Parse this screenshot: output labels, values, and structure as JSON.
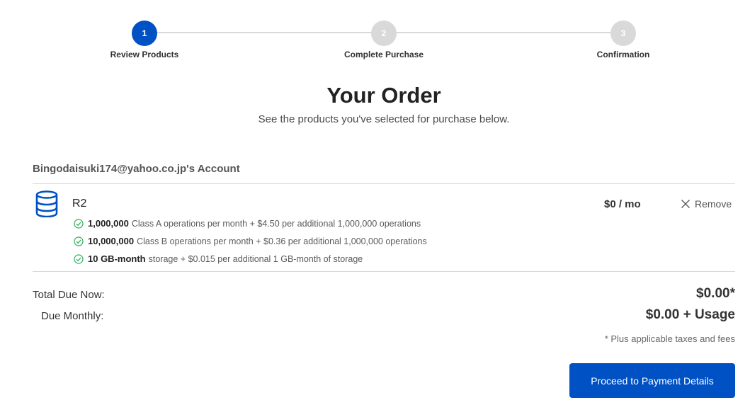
{
  "stepper": {
    "steps": [
      {
        "number": "1",
        "label": "Review Products",
        "active": true
      },
      {
        "number": "2",
        "label": "Complete Purchase",
        "active": false
      },
      {
        "number": "3",
        "label": "Confirmation",
        "active": false
      }
    ]
  },
  "header": {
    "title": "Your Order",
    "subtitle": "See the products you've selected for purchase below."
  },
  "account": {
    "label": "Bingodaisuki174@yahoo.co.jp's Account"
  },
  "product": {
    "icon": "database-icon",
    "name": "R2",
    "price": "$0 / mo",
    "remove_label": "Remove",
    "features": [
      {
        "bold": "1,000,000",
        "text": "Class A operations per month + $4.50 per additional 1,000,000 operations"
      },
      {
        "bold": "10,000,000",
        "text": "Class B operations per month + $0.36 per additional 1,000,000 operations"
      },
      {
        "bold": "10 GB-month",
        "text": "storage + $0.015 per additional 1 GB-month of storage"
      }
    ]
  },
  "totals": {
    "due_now_label": "Total Due Now:",
    "due_now_value": "$0.00*",
    "monthly_label": "Due Monthly:",
    "monthly_value": "$0.00 + Usage",
    "note": "* Plus applicable taxes and fees"
  },
  "actions": {
    "proceed_label": "Proceed to Payment Details"
  },
  "colors": {
    "accent": "#0051c3",
    "success": "#2eae5c",
    "inactive": "#d9d9d9"
  }
}
